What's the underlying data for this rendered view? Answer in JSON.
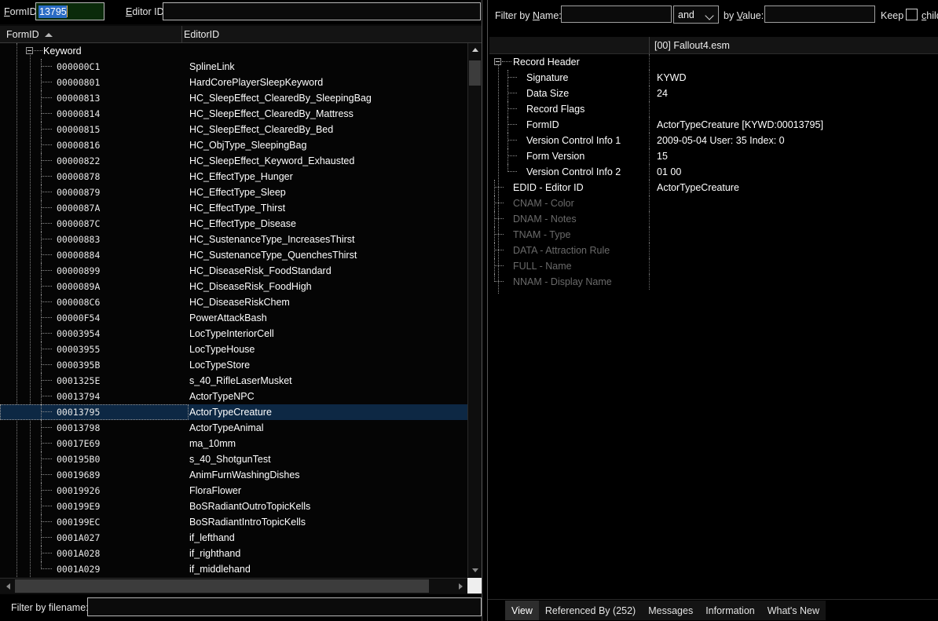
{
  "left": {
    "toolbar": {
      "formid_label": "FormID",
      "formid_value": "13795",
      "editorid_label": "Editor ID",
      "editorid_value": ""
    },
    "columns": {
      "formid": "FormID",
      "editorid": "EditorID",
      "sort_indicator": "sort-ascending-icon"
    },
    "group_label": "Keyword",
    "rows": [
      {
        "formid": "000000C1",
        "editorid": "SplineLink"
      },
      {
        "formid": "00000801",
        "editorid": "HardCorePlayerSleepKeyword"
      },
      {
        "formid": "00000813",
        "editorid": "HC_SleepEffect_ClearedBy_SleepingBag"
      },
      {
        "formid": "00000814",
        "editorid": "HC_SleepEffect_ClearedBy_Mattress"
      },
      {
        "formid": "00000815",
        "editorid": "HC_SleepEffect_ClearedBy_Bed"
      },
      {
        "formid": "00000816",
        "editorid": "HC_ObjType_SleepingBag"
      },
      {
        "formid": "00000822",
        "editorid": "HC_SleepEffect_Keyword_Exhausted"
      },
      {
        "formid": "00000878",
        "editorid": "HC_EffectType_Hunger"
      },
      {
        "formid": "00000879",
        "editorid": "HC_EffectType_Sleep"
      },
      {
        "formid": "0000087A",
        "editorid": "HC_EffectType_Thirst"
      },
      {
        "formid": "0000087C",
        "editorid": "HC_EffectType_Disease"
      },
      {
        "formid": "00000883",
        "editorid": "HC_SustenanceType_IncreasesThirst"
      },
      {
        "formid": "00000884",
        "editorid": "HC_SustenanceType_QuenchesThirst"
      },
      {
        "formid": "00000899",
        "editorid": "HC_DiseaseRisk_FoodStandard"
      },
      {
        "formid": "0000089A",
        "editorid": "HC_DiseaseRisk_FoodHigh"
      },
      {
        "formid": "000008C6",
        "editorid": "HC_DiseaseRiskChem"
      },
      {
        "formid": "00000F54",
        "editorid": "PowerAttackBash"
      },
      {
        "formid": "00003954",
        "editorid": "LocTypeInteriorCell"
      },
      {
        "formid": "00003955",
        "editorid": "LocTypeHouse"
      },
      {
        "formid": "0000395B",
        "editorid": "LocTypeStore"
      },
      {
        "formid": "0001325E",
        "editorid": "s_40_RifleLaserMusket"
      },
      {
        "formid": "00013794",
        "editorid": "ActorTypeNPC"
      },
      {
        "formid": "00013795",
        "editorid": "ActorTypeCreature",
        "selected": true
      },
      {
        "formid": "00013798",
        "editorid": "ActorTypeAnimal"
      },
      {
        "formid": "00017E69",
        "editorid": "ma_10mm"
      },
      {
        "formid": "000195B0",
        "editorid": "s_40_ShotgunTest"
      },
      {
        "formid": "00019689",
        "editorid": "AnimFurnWashingDishes"
      },
      {
        "formid": "00019926",
        "editorid": "FloraFlower"
      },
      {
        "formid": "000199E9",
        "editorid": "BoSRadiantOutroTopicKells"
      },
      {
        "formid": "000199EC",
        "editorid": "BoSRadiantIntroTopicKells"
      },
      {
        "formid": "0001A027",
        "editorid": "if_lefthand"
      },
      {
        "formid": "0001A028",
        "editorid": "if_righthand"
      },
      {
        "formid": "0001A029",
        "editorid": "if_middlehand"
      }
    ],
    "filter": {
      "label": "Filter by filename:",
      "value": "",
      "placeholder": ""
    },
    "scrollbars": {
      "v_up_icon": "scroll-up-arrow-icon",
      "v_down_icon": "scroll-down-arrow-icon",
      "h_left_icon": "scroll-left-arrow-icon",
      "h_right_icon": "scroll-right-arrow-icon"
    }
  },
  "right": {
    "filterbar": {
      "name_label": "Filter by Name:",
      "name_value": "",
      "operator_value": "and",
      "operator_icon": "chevron-down-icon",
      "value_label": "by Value:",
      "value_value": "",
      "keep_label": "Keep",
      "keep_checked": false,
      "child_label": "child"
    },
    "file_header": "[00] Fallout4.esm",
    "tree": [
      {
        "label": "Record Header",
        "value": "",
        "depth": 0,
        "expanded": true,
        "dim": false
      },
      {
        "label": "Signature",
        "value": "KYWD",
        "depth": 1,
        "dim": false
      },
      {
        "label": "Data Size",
        "value": "24",
        "depth": 1,
        "dim": false
      },
      {
        "label": "Record Flags",
        "value": "",
        "depth": 1,
        "dim": false
      },
      {
        "label": "FormID",
        "value": "ActorTypeCreature [KYWD:00013795]",
        "depth": 1,
        "dim": false
      },
      {
        "label": "Version Control Info 1",
        "value": "2009-05-04 User: 35 Index: 0",
        "depth": 1,
        "dim": false
      },
      {
        "label": "Form Version",
        "value": "15",
        "depth": 1,
        "dim": false
      },
      {
        "label": "Version Control Info 2",
        "value": "01 00",
        "depth": 1,
        "dim": false,
        "last": true
      },
      {
        "label": "EDID - Editor ID",
        "value": "ActorTypeCreature",
        "depth": 0,
        "dim": false
      },
      {
        "label": "CNAM - Color",
        "value": "",
        "depth": 0,
        "dim": true
      },
      {
        "label": "DNAM - Notes",
        "value": "",
        "depth": 0,
        "dim": true
      },
      {
        "label": "TNAM - Type",
        "value": "",
        "depth": 0,
        "dim": true
      },
      {
        "label": "DATA - Attraction Rule",
        "value": "",
        "depth": 0,
        "dim": true
      },
      {
        "label": "FULL - Name",
        "value": "",
        "depth": 0,
        "dim": true
      },
      {
        "label": "NNAM - Display Name",
        "value": "",
        "depth": 0,
        "dim": true,
        "last": true
      }
    ],
    "tabs": [
      {
        "label": "View",
        "active": true
      },
      {
        "label": "Referenced By (252)",
        "active": false
      },
      {
        "label": "Messages",
        "active": false
      },
      {
        "label": "Information",
        "active": false
      },
      {
        "label": "What's New",
        "active": false
      }
    ]
  },
  "theme": {
    "accent_selection": "#0d2844",
    "text_highlight": "#2a6cc4",
    "field_green": "#0a2a0a",
    "dim_text": "#6a6a6a"
  }
}
